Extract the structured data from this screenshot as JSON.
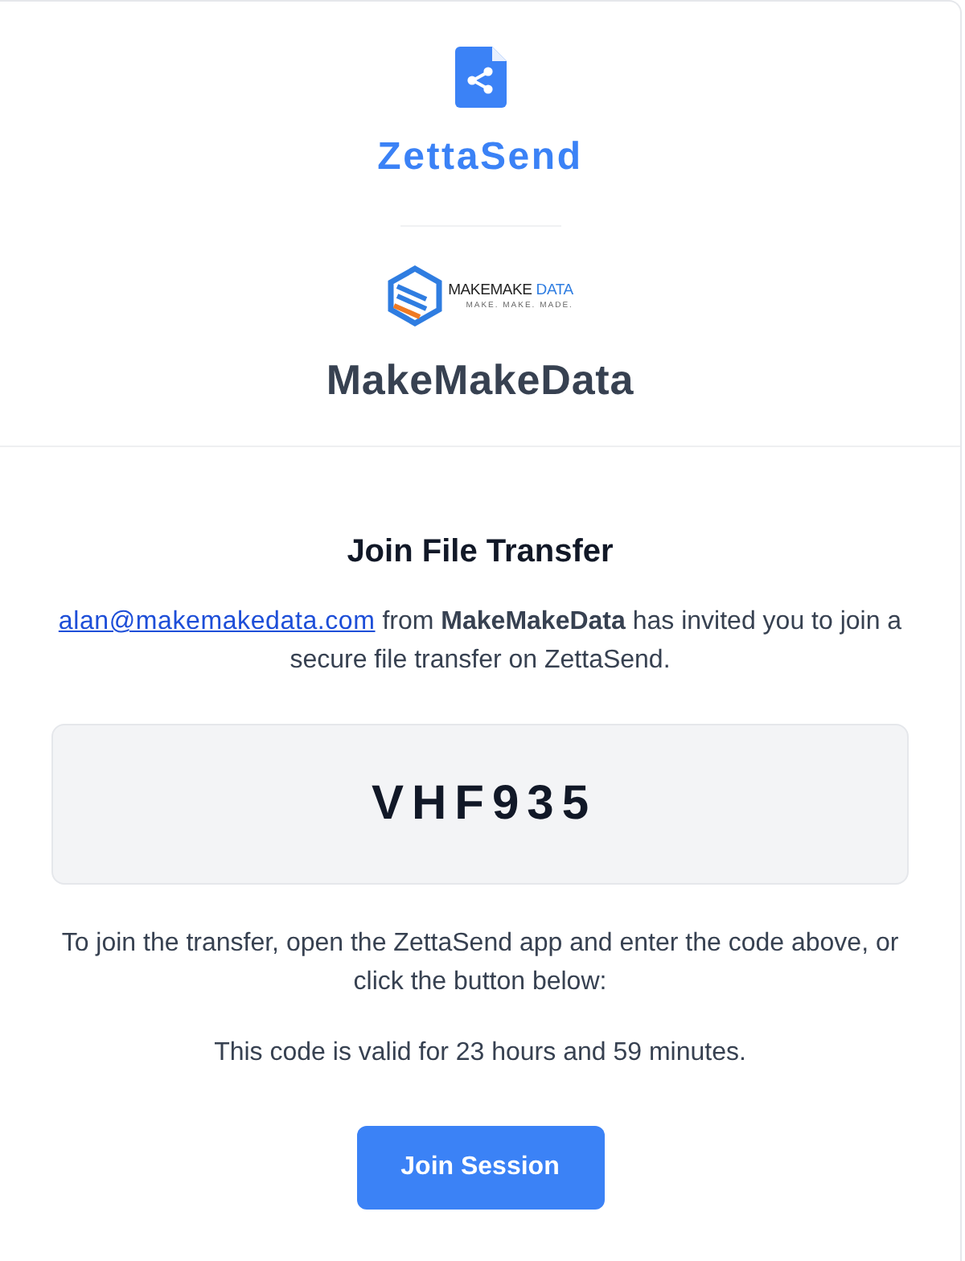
{
  "header": {
    "app_name": "ZettaSend",
    "company_logo": {
      "name": "MAKEMAKE",
      "suffix": "DATA",
      "tagline": "MAKE. MAKE. MADE."
    },
    "company_name": "MakeMakeData"
  },
  "invitation": {
    "title": "Join File Transfer",
    "sender_email": "alan@makemakedata.com",
    "message": "from **MakeMakeData** has invited you to join a secure file transfer on ZettaSend.",
    "code": "VHF935",
    "instructions": "To join the transfer, open the ZettaSend app and enter the code above, or click the button below:",
    "validity": "This code is valid for 23 hours and 59 minutes.",
    "button": "Join Session"
  }
}
